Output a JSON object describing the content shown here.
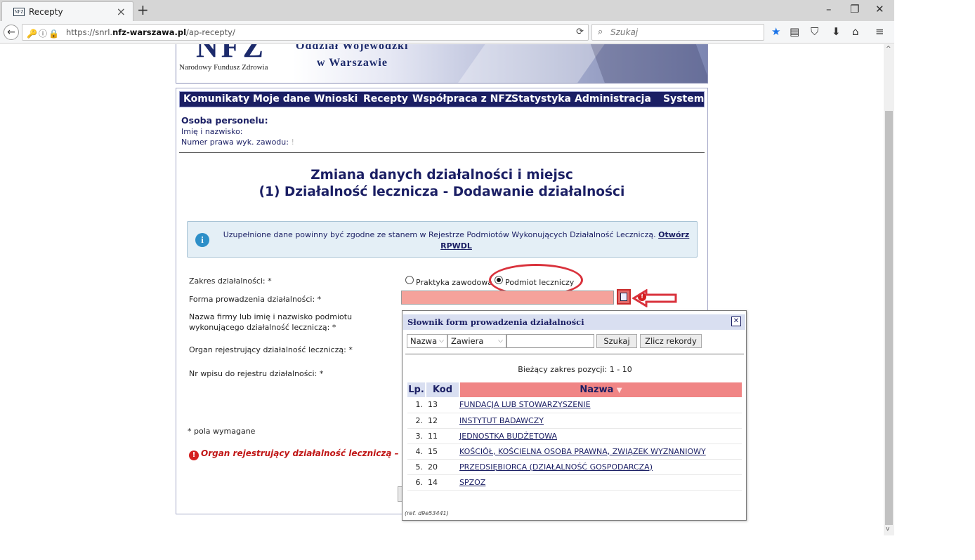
{
  "browser": {
    "tab_title": "Recepty",
    "favicon_text": "NFZ",
    "url_prefix": "https://snrl.",
    "url_domain": "nfz-warszawa.pl",
    "url_path": "/ap-recepty/",
    "search_placeholder": "Szukaj"
  },
  "banner": {
    "logo": "NFZ",
    "fund_name": "Narodowy Fundusz Zdrowia",
    "line1": "Oddział Wojewódzki",
    "line2": "w Warszawie"
  },
  "menu": {
    "items": [
      "Komunikaty",
      "Moje dane",
      "Wnioski",
      "Recepty",
      "Współpraca z NFZ",
      "Statystyka",
      "Administracja",
      "System"
    ]
  },
  "personnel": {
    "title": "Osoba personelu:",
    "name_label": "Imię i nazwisko:",
    "license_label": "Numer prawa wyk. zawodu:",
    "license_value": "!"
  },
  "page": {
    "title_line1": "Zmiana danych działalności i miejsc",
    "title_line2": "(1) Działalność lecznicza - Dodawanie działalności"
  },
  "info": {
    "message": "Uzupełnione dane powinny być zgodne ze stanem w Rejestrze Podmiotów Wykonujących Działalność Leczniczą.",
    "link": "Otwórz RPWDL"
  },
  "form": {
    "scope_label": "Zakres działalności: *",
    "radio_practice": "Praktyka zawodowa",
    "radio_entity": "Podmiot leczniczy",
    "radio_selected": "Podmiot leczniczy",
    "form_label": "Forma prowadzenia działalności: *",
    "form_value": "",
    "company_label_1": "Nazwa firmy lub imię i nazwisko podmiotu",
    "company_label_2": "wykonującego działalność leczniczą: *",
    "organ_label": "Organ rejestrujący działalność leczniczą: *",
    "registry_label": "Nr wpisu do rejestru działalności: *",
    "required_note": "* pola wymagane",
    "error_text": "Organ rejestrujący działalność leczniczą – to po"
  },
  "popup": {
    "title": "Słownik form prowadzenia działalności",
    "field_select": "Nazwa",
    "op_select": "Zawiera",
    "search_value": "",
    "search_button": "Szukaj",
    "count_button": "Zlicz rekordy",
    "range_text": "Bieżący zakres pozycji: 1 - 10",
    "columns": {
      "lp": "Lp.",
      "kod": "Kod",
      "nazwa": "Nazwa"
    },
    "rows": [
      {
        "lp": "1.",
        "kod": "13",
        "nazwa": "FUNDACJA LUB STOWARZYSZENIE"
      },
      {
        "lp": "2.",
        "kod": "12",
        "nazwa": "INSTYTUT BADAWCZY"
      },
      {
        "lp": "3.",
        "kod": "11",
        "nazwa": "JEDNOSTKA BUDŻETOWA"
      },
      {
        "lp": "4.",
        "kod": "15",
        "nazwa": "KOŚCIÓŁ, KOŚCIELNA OSOBA PRAWNA, ZWIĄZEK WYZNANIOWY"
      },
      {
        "lp": "5.",
        "kod": "20",
        "nazwa": "PRZEDSIĘBIORCA (DZIAŁALNOŚĆ GOSPODARCZA)"
      },
      {
        "lp": "6.",
        "kod": "14",
        "nazwa": "SPZOZ"
      }
    ],
    "ref": "(ref. d9e53441)"
  },
  "colors": {
    "menu_bg": "#1b1f64",
    "required_field": "#f5a29b",
    "annotation_red": "#d9323c",
    "sorted_header": "#f08585"
  }
}
